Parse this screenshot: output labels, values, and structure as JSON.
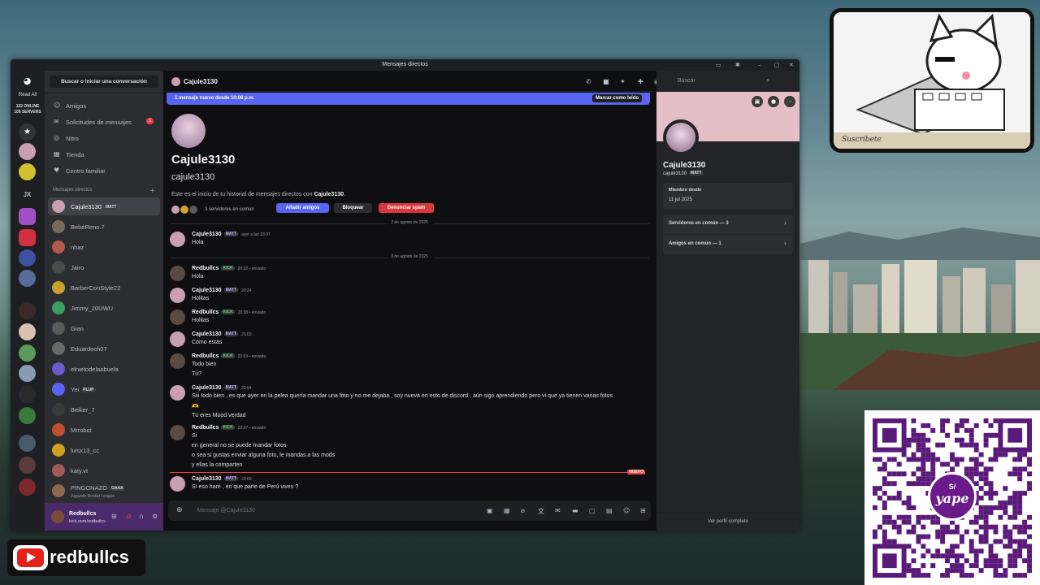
{
  "window": {
    "title": "Mensajes directos"
  },
  "servers": {
    "read_all": "Read All",
    "online": "132 ONLINE",
    "total": "109 SERVERS",
    "jx": "JX"
  },
  "dms": {
    "search": "Buscar o iniciar una conversación",
    "nav": [
      {
        "label": "Amigos",
        "icon": "friends-icon"
      },
      {
        "label": "Solicitudes de mensajes",
        "icon": "inbox-icon",
        "badge": "1"
      },
      {
        "label": "Nitro",
        "icon": "nitro-icon"
      },
      {
        "label": "Tienda",
        "icon": "shop-icon"
      },
      {
        "label": "Centro familiar",
        "icon": "family-icon"
      }
    ],
    "header": "Mensajes directos",
    "items": [
      {
        "name": "Cajule3130",
        "tag": "MATT",
        "color": "#c9a0b0"
      },
      {
        "name": "BebéReno.7",
        "color": "#7a6a5a"
      },
      {
        "name": "nhaz",
        "color": "#b55a4a"
      },
      {
        "name": "Jairo",
        "color": "#4a4a4a"
      },
      {
        "name": "BarberConStyle22",
        "color": "#c8a030"
      },
      {
        "name": "Jimmy_20UWU",
        "color": "#3aa060"
      },
      {
        "name": "Gian",
        "color": "#5a5a5a"
      },
      {
        "name": "Eduardoch07",
        "color": "#6a6a6a"
      },
      {
        "name": "elnietodelaabuela",
        "color": "#6a5acd"
      },
      {
        "name": "Yei",
        "tag": "PLUP",
        "color": "#5865f2"
      },
      {
        "name": "Beiker_7",
        "color": "#3a3a3a"
      },
      {
        "name": "Mrrobot",
        "color": "#c05030"
      },
      {
        "name": "luisx13_cc",
        "color": "#d0a020"
      },
      {
        "name": "katy.vt",
        "color": "#a05a5a"
      },
      {
        "name": "PINGONAZO",
        "tag": "GAAA",
        "color": "#8a6a4a"
      }
    ],
    "pingonazo_status": "Jugando Rocket League",
    "user": {
      "name": "Redbullcs",
      "status": "kick.com/redbullcs"
    }
  },
  "channel": {
    "name": "Cajule3130",
    "search_placeholder": "Buscar",
    "banner": "1 mensaje nuevo desde 10:06 p.m.",
    "mark_read": "Marcar como leído",
    "intro_name": "Cajule3130",
    "intro_user": "cajule3130",
    "intro_text_pre": "Este es el inicio de tu historial de mensajes directos con ",
    "intro_text_name": "Cajule3130",
    "intro_text_post": ".",
    "mutual": "3 servidores en común",
    "add_friend": "Añadir amigos",
    "block": "Bloquear",
    "report": "Denunciar spam",
    "date1": "2 de agosto de 2025",
    "date2": "3 de agosto de 2025",
    "new_label": "NUEVO",
    "composer_placeholder": "Mensaje @Cajule3130"
  },
  "messages": [
    {
      "author": "Cajule3130",
      "tag": "MATT",
      "time": "ayer a las 23:37",
      "lines": [
        "Hola"
      ],
      "mine": false
    },
    {
      "author": "Redbullcs",
      "tag": "KICK",
      "time": "20:22 • enviado",
      "lines": [
        "Hola"
      ],
      "mine": true
    },
    {
      "author": "Cajule3130",
      "tag": "MATT",
      "time": "20:24",
      "lines": [
        "Holitas"
      ],
      "mine": false
    },
    {
      "author": "Redbullcs",
      "tag": "KICK",
      "time": "20:28 • enviado",
      "lines": [
        "Holitas"
      ],
      "mine": true
    },
    {
      "author": "Cajule3130",
      "tag": "MATT",
      "time": "21:03",
      "lines": [
        "Cómo estás"
      ],
      "mine": false
    },
    {
      "author": "Redbullcs",
      "tag": "KICK",
      "time": "22:03 • enviado",
      "lines": [
        "Todo bien",
        "Tú?"
      ],
      "mine": true
    },
    {
      "author": "Cajule3130",
      "tag": "MATT",
      "time": "22:04",
      "lines": [
        "Siii todo bien , es que ayer en la pelea quería mandar una foto y no me dejaba , soy nueva en esto de discord , aún sigo aprendiendo pero vi que ya tienen varias fotos",
        "🫶",
        "Tú eres Mood verdad"
      ],
      "mine": false
    },
    {
      "author": "Redbullcs",
      "tag": "KICK",
      "time": "22:07 • enviado",
      "lines": [
        "Si",
        "en general no se puede mandar fotos",
        "o sea si gustas enviar alguna foto, le mandas a las mods",
        "y ellas la comparten"
      ],
      "mine": true
    },
    {
      "author": "Cajule3130",
      "tag": "MATT",
      "time": "22:08",
      "lines": [
        "Sí eso haré , en que parte de Perú vives ?"
      ],
      "mine": false
    }
  ],
  "profile": {
    "name": "Cajule3130",
    "user": "cajule3130",
    "tag": "MATT",
    "member_since_label": "Miembro desde",
    "member_since": "11 jul 2025",
    "mutual_servers": "Servidores en común — 3",
    "mutual_friends": "Amigos en común — 1",
    "full_profile": "Ver perfil completo"
  },
  "overlay": {
    "channel": "redbullcs",
    "qr_brand": "yape",
    "qr_currency": "S/",
    "sign_text": "Suscribete"
  }
}
